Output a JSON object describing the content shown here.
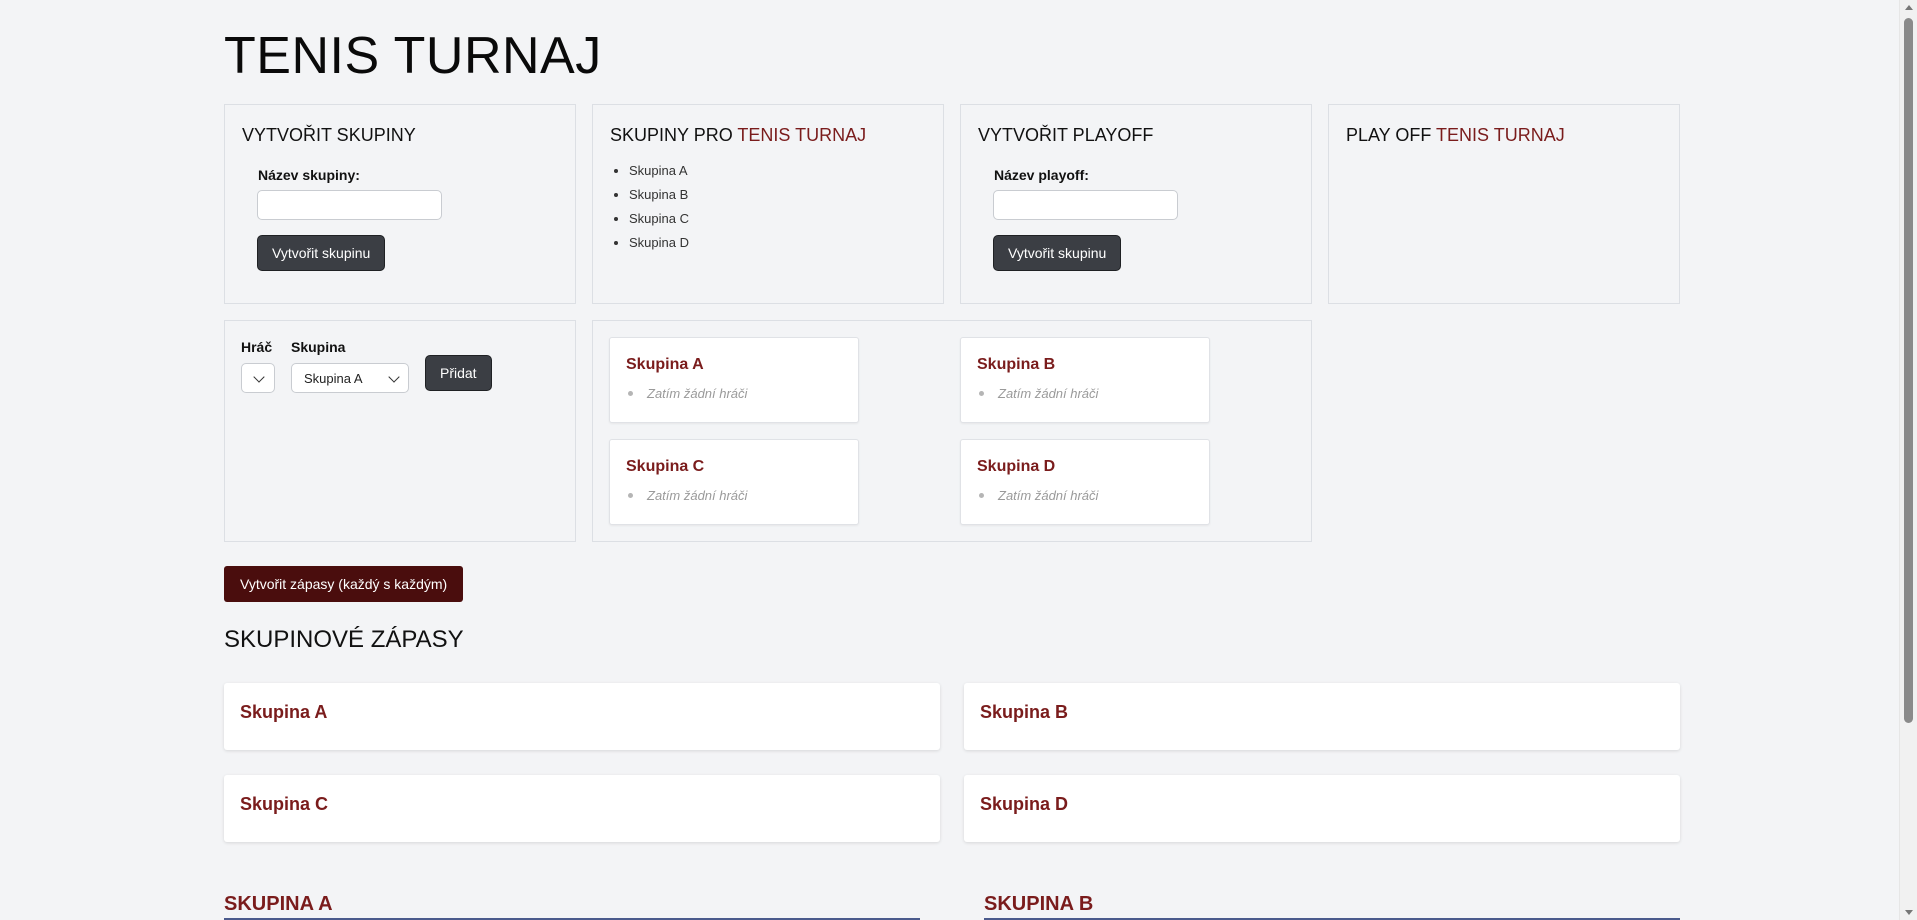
{
  "page": {
    "title": "TENIS TURNAJ"
  },
  "create_groups": {
    "title": "VYTVOŘIT SKUPINY",
    "name_label": "Název skupiny:",
    "name_value": "",
    "button_label": "Vytvořit skupinu"
  },
  "groups_list": {
    "title_prefix": "SKUPINY PRO ",
    "title_accent": "TENIS TURNAJ",
    "items": [
      "Skupina A",
      "Skupina B",
      "Skupina C",
      "Skupina D"
    ]
  },
  "create_playoff": {
    "title": "VYTVOŘIT PLAYOFF",
    "name_label": "Název playoff:",
    "name_value": "",
    "button_label": "Vytvořit skupinu"
  },
  "playoff": {
    "title_prefix": "PLAY OFF ",
    "title_accent": "TENIS TURNAJ"
  },
  "add_player": {
    "player_label": "Hráč",
    "player_value": "",
    "group_label": "Skupina",
    "group_value": "Skupina A",
    "button_label": "Přidat"
  },
  "group_cards": [
    {
      "title": "Skupina A",
      "empty_text": "Zatím žádní hráči"
    },
    {
      "title": "Skupina B",
      "empty_text": "Zatím žádní hráči"
    },
    {
      "title": "Skupina C",
      "empty_text": "Zatím žádní hráči"
    },
    {
      "title": "Skupina D",
      "empty_text": "Zatím žádní hráči"
    }
  ],
  "create_matches_button": "Vytvořit zápasy (každý s každým)",
  "group_matches": {
    "title": "SKUPINOVÉ ZÁPASY",
    "cards": [
      "Skupina A",
      "Skupina B",
      "Skupina C",
      "Skupina D"
    ]
  },
  "standings": {
    "left_title": "SKUPINA A",
    "right_title": "SKUPINA B"
  },
  "colors": {
    "accent": "#7a1c1c",
    "dark_button": "#3b3e44",
    "maroon_button": "#4a0d0d",
    "background": "#f3f4f6"
  }
}
